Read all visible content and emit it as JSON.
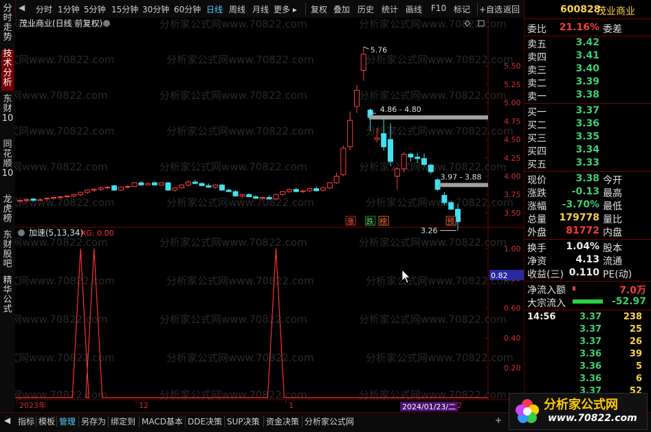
{
  "toolbar": {
    "items": [
      "分时",
      "1分钟",
      "5分钟",
      "15分钟",
      "30分钟",
      "60分钟",
      "日线",
      "周线",
      "月线",
      "更多 ▸",
      "复权",
      "叠加",
      "历史",
      "统计",
      "画线",
      "F10",
      "标记",
      "+自选",
      "返回"
    ]
  },
  "left_tabs": [
    "分时走势",
    "技术分析",
    "东财10",
    "同花顺10",
    "龙虎榜",
    "东财股吧",
    "精华公式"
  ],
  "chart": {
    "title": "茂业商业(日线 前复权)",
    "watermark": "分析家公式网www.70822.com",
    "price_labels": [
      "5.50",
      "5.25",
      "5.00",
      "4.75",
      "4.50",
      "4.25",
      "4.00",
      "3.75",
      "3.50"
    ],
    "high_label": "5.76",
    "low_label": "3.26",
    "range_label_1": "4.86 - 4.80",
    "range_label_2": "3.97 - 3.88",
    "badges": [
      "涨",
      "跌",
      "榜",
      "预"
    ],
    "indicator_title": "加速(5,13,34)",
    "indicator_value": "XG: 0.00",
    "indicator_labels": [
      "1.00",
      "0.80",
      "0.60",
      "0.40",
      "0.20"
    ],
    "indicator_current": "0.82",
    "date_labels": [
      "2023年",
      "12",
      "1",
      "2"
    ],
    "cursor_date": "2024/01/23/二"
  },
  "chart_data": {
    "type": "candlestick",
    "title": "茂业商业(日线 前复权)",
    "ylim": [
      3.35,
      5.95
    ],
    "y_ticks": [
      3.5,
      3.75,
      4.0,
      4.25,
      4.5,
      4.75,
      5.0,
      5.25,
      5.5
    ],
    "candles": [
      {
        "o": 3.66,
        "h": 3.68,
        "l": 3.64,
        "c": 3.67
      },
      {
        "o": 3.67,
        "h": 3.69,
        "l": 3.65,
        "c": 3.68
      },
      {
        "o": 3.69,
        "h": 3.7,
        "l": 3.66,
        "c": 3.67
      },
      {
        "o": 3.68,
        "h": 3.7,
        "l": 3.67,
        "c": 3.68
      },
      {
        "o": 3.69,
        "h": 3.71,
        "l": 3.66,
        "c": 3.7
      },
      {
        "o": 3.7,
        "h": 3.72,
        "l": 3.68,
        "c": 3.71
      },
      {
        "o": 3.71,
        "h": 3.73,
        "l": 3.69,
        "c": 3.72
      },
      {
        "o": 3.72,
        "h": 3.74,
        "l": 3.7,
        "c": 3.73
      },
      {
        "o": 3.73,
        "h": 3.76,
        "l": 3.71,
        "c": 3.75
      },
      {
        "o": 3.75,
        "h": 3.79,
        "l": 3.73,
        "c": 3.78
      },
      {
        "o": 3.78,
        "h": 3.82,
        "l": 3.76,
        "c": 3.81
      },
      {
        "o": 3.81,
        "h": 3.84,
        "l": 3.79,
        "c": 3.82
      },
      {
        "o": 3.82,
        "h": 3.86,
        "l": 3.8,
        "c": 3.84
      },
      {
        "o": 3.84,
        "h": 3.87,
        "l": 3.82,
        "c": 3.85
      },
      {
        "o": 3.87,
        "h": 3.88,
        "l": 3.8,
        "c": 3.81
      },
      {
        "o": 3.81,
        "h": 3.86,
        "l": 3.8,
        "c": 3.85
      },
      {
        "o": 3.85,
        "h": 3.88,
        "l": 3.83,
        "c": 3.86
      },
      {
        "o": 3.86,
        "h": 3.92,
        "l": 3.85,
        "c": 3.91
      },
      {
        "o": 3.91,
        "h": 3.93,
        "l": 3.87,
        "c": 3.88
      },
      {
        "o": 3.88,
        "h": 3.91,
        "l": 3.87,
        "c": 3.9
      },
      {
        "o": 3.91,
        "h": 3.93,
        "l": 3.87,
        "c": 3.88
      },
      {
        "o": 3.88,
        "h": 3.92,
        "l": 3.87,
        "c": 3.91
      },
      {
        "o": 3.91,
        "h": 3.92,
        "l": 3.8,
        "c": 3.81
      },
      {
        "o": 3.81,
        "h": 3.85,
        "l": 3.79,
        "c": 3.84
      },
      {
        "o": 3.84,
        "h": 3.89,
        "l": 3.83,
        "c": 3.88
      },
      {
        "o": 3.88,
        "h": 3.94,
        "l": 3.86,
        "c": 3.92
      },
      {
        "o": 3.92,
        "h": 3.95,
        "l": 3.89,
        "c": 3.9
      },
      {
        "o": 3.9,
        "h": 3.92,
        "l": 3.86,
        "c": 3.87
      },
      {
        "o": 3.87,
        "h": 3.9,
        "l": 3.84,
        "c": 3.85
      },
      {
        "o": 3.85,
        "h": 3.89,
        "l": 3.83,
        "c": 3.88
      },
      {
        "o": 3.88,
        "h": 3.9,
        "l": 3.8,
        "c": 3.81
      },
      {
        "o": 3.81,
        "h": 3.83,
        "l": 3.78,
        "c": 3.79
      },
      {
        "o": 3.79,
        "h": 3.81,
        "l": 3.72,
        "c": 3.73
      },
      {
        "o": 3.73,
        "h": 3.76,
        "l": 3.7,
        "c": 3.75
      },
      {
        "o": 3.75,
        "h": 3.77,
        "l": 3.71,
        "c": 3.72
      },
      {
        "o": 3.72,
        "h": 3.74,
        "l": 3.69,
        "c": 3.7
      },
      {
        "o": 3.7,
        "h": 3.72,
        "l": 3.67,
        "c": 3.71
      },
      {
        "o": 3.71,
        "h": 3.74,
        "l": 3.68,
        "c": 3.69
      },
      {
        "o": 3.69,
        "h": 3.76,
        "l": 3.68,
        "c": 3.75
      },
      {
        "o": 3.75,
        "h": 3.8,
        "l": 3.73,
        "c": 3.79
      },
      {
        "o": 3.79,
        "h": 3.83,
        "l": 3.77,
        "c": 3.82
      },
      {
        "o": 3.82,
        "h": 3.84,
        "l": 3.78,
        "c": 3.79
      },
      {
        "o": 3.79,
        "h": 3.81,
        "l": 3.77,
        "c": 3.8
      },
      {
        "o": 3.8,
        "h": 3.84,
        "l": 3.78,
        "c": 3.83
      },
      {
        "o": 3.83,
        "h": 3.86,
        "l": 3.79,
        "c": 3.8
      },
      {
        "o": 3.81,
        "h": 3.85,
        "l": 3.79,
        "c": 3.84
      },
      {
        "o": 3.84,
        "h": 3.92,
        "l": 3.82,
        "c": 3.91
      },
      {
        "o": 3.91,
        "h": 4.05,
        "l": 3.89,
        "c": 4.0
      },
      {
        "o": 4.02,
        "h": 4.42,
        "l": 4.0,
        "c": 4.38
      },
      {
        "o": 4.4,
        "h": 4.88,
        "l": 4.35,
        "c": 4.76
      },
      {
        "o": 4.95,
        "h": 5.24,
        "l": 4.86,
        "c": 5.17
      },
      {
        "o": 5.44,
        "h": 5.76,
        "l": 5.3,
        "c": 5.66
      },
      {
        "o": 4.9,
        "h": 4.92,
        "l": 4.62,
        "c": 4.8
      },
      {
        "o": 4.5,
        "h": 4.66,
        "l": 4.46,
        "c": 4.52
      },
      {
        "o": 4.58,
        "h": 4.8,
        "l": 4.35,
        "c": 4.4
      },
      {
        "o": 4.5,
        "h": 4.72,
        "l": 4.14,
        "c": 4.2
      },
      {
        "o": 4.0,
        "h": 4.12,
        "l": 3.82,
        "c": 4.1
      },
      {
        "o": 4.1,
        "h": 4.33,
        "l": 4.05,
        "c": 4.3
      },
      {
        "o": 4.3,
        "h": 4.32,
        "l": 4.2,
        "c": 4.26
      },
      {
        "o": 4.26,
        "h": 4.32,
        "l": 4.18,
        "c": 4.24
      },
      {
        "o": 4.24,
        "h": 4.31,
        "l": 4.14,
        "c": 4.16
      },
      {
        "o": 4.15,
        "h": 4.17,
        "l": 4.03,
        "c": 4.06
      },
      {
        "o": 3.95,
        "h": 3.97,
        "l": 3.8,
        "c": 3.82
      },
      {
        "o": 3.74,
        "h": 3.78,
        "l": 3.6,
        "c": 3.64
      },
      {
        "o": 3.64,
        "h": 3.66,
        "l": 3.54,
        "c": 3.55
      },
      {
        "o": 3.55,
        "h": 3.62,
        "l": 3.26,
        "c": 3.38
      }
    ],
    "indicator": {
      "name": "加速(5,13,34)",
      "series_name": "XG",
      "ylim": [
        0,
        1.05
      ],
      "y_ticks": [
        0.2,
        0.4,
        0.6,
        0.8,
        1.0
      ],
      "spikes_at_candle": [
        9,
        11,
        38
      ],
      "current": 0.82
    }
  },
  "quote": {
    "code": "600828",
    "name": "茂业商业",
    "weibi_label": "委比",
    "weibi": "21.16%",
    "weicha_label": "委差",
    "sell": [
      {
        "label": "卖五",
        "price": "3.42"
      },
      {
        "label": "卖四",
        "price": "3.41"
      },
      {
        "label": "卖三",
        "price": "3.40"
      },
      {
        "label": "卖二",
        "price": "3.39"
      },
      {
        "label": "卖一",
        "price": "3.38"
      }
    ],
    "buy": [
      {
        "label": "买一",
        "price": "3.37"
      },
      {
        "label": "买二",
        "price": "3.36"
      },
      {
        "label": "买三",
        "price": "3.35"
      },
      {
        "label": "买四",
        "price": "3.34"
      },
      {
        "label": "买五",
        "price": "3.33"
      }
    ],
    "stats": [
      {
        "label": "现价",
        "value": "3.38",
        "label2": "今开",
        "cls": "green"
      },
      {
        "label": "涨跌",
        "value": "-0.13",
        "label2": "最高",
        "cls": "green"
      },
      {
        "label": "涨幅",
        "value": "-3.70%",
        "label2": "最低",
        "cls": "green"
      },
      {
        "label": "总量",
        "value": "179778",
        "label2": "量比",
        "cls": "yellow"
      },
      {
        "label": "外盘",
        "value": "81772",
        "label2": "内盘",
        "cls": "red"
      }
    ],
    "stats2": [
      {
        "label": "换手",
        "value": "1.04%",
        "label2": "股本",
        "cls": "white"
      },
      {
        "label": "净资",
        "value": "4.13",
        "label2": "流通",
        "cls": "white"
      },
      {
        "label": "收益(三)",
        "value": "0.110",
        "label2": "PE(动)",
        "cls": "white"
      }
    ],
    "flow": [
      {
        "label": "净流入额",
        "value": "7.0万",
        "cls": "red"
      },
      {
        "label": "大宗流入",
        "value": "-52.97",
        "cls": "green"
      }
    ],
    "ticks": [
      {
        "time": "14:56",
        "price": "3.37",
        "vol": "238"
      },
      {
        "time": "",
        "price": "3.37",
        "vol": "25"
      },
      {
        "time": "",
        "price": "3.37",
        "vol": "26"
      },
      {
        "time": "",
        "price": "3.36",
        "vol": "39"
      },
      {
        "time": "",
        "price": "3.36",
        "vol": "5"
      },
      {
        "time": "",
        "price": "3.36",
        "vol": "6"
      },
      {
        "time": "",
        "price": "3.37",
        "vol": "52"
      }
    ]
  },
  "bottombar": {
    "items": [
      "指标",
      "模板",
      "管理",
      "另存为",
      "绑定到",
      "MACD基本",
      "DDE决策",
      "SUP决策",
      "资金决策",
      "分析家公式网"
    ],
    "plus": "+"
  },
  "logo": {
    "title": "分析家公式网",
    "url": "www.70822.com"
  },
  "colors": {
    "up": "#ff4040",
    "down": "#40e0f0",
    "indicator": "#ff3030",
    "frame": "#7a0000",
    "accent": "#4fd0ff"
  }
}
